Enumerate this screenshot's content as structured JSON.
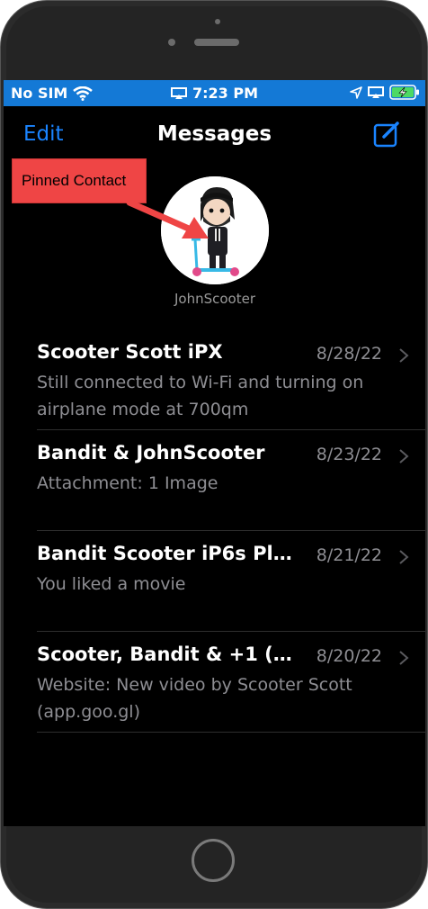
{
  "status": {
    "carrier": "No SIM",
    "time": "7:23 PM",
    "icons": [
      "wifi-icon",
      "screen-mirroring-icon",
      "location-icon",
      "airplay-icon",
      "battery-charging-icon"
    ]
  },
  "nav": {
    "edit": "Edit",
    "title": "Messages",
    "compose_icon": "compose-icon"
  },
  "pinned": {
    "name": "JohnScooter"
  },
  "annotation": {
    "label": "Pinned Contact",
    "color": "#ef4545"
  },
  "conversations": [
    {
      "name": "Scooter Scott iPX",
      "date": "8/28/22",
      "preview": "Still connected to Wi-Fi and turning on airplane mode at 700qm"
    },
    {
      "name": "Bandit & JohnScooter",
      "date": "8/23/22",
      "preview": "Attachment: 1 Image"
    },
    {
      "name": "Bandit Scooter iP6s Plus",
      "date": "8/21/22",
      "preview": "You liked a movie"
    },
    {
      "name": "Scooter, Bandit & +1 (7...",
      "date": "8/20/22",
      "preview": "Website: New video by Scooter Scott (app.goo.gl)"
    }
  ],
  "colors": {
    "accent": "#1a84ff",
    "statusbar": "#1479d6",
    "background": "#000000",
    "secondary_text": "#8e8e93"
  }
}
